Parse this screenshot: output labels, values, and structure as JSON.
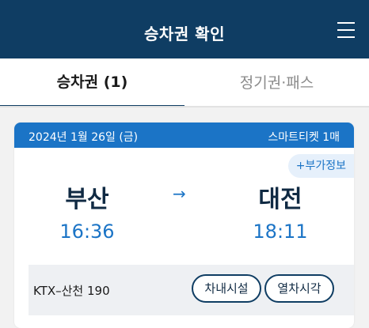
{
  "header": {
    "title": "승차권 확인",
    "menu_icon": "hamburger-menu-icon"
  },
  "tabs": [
    {
      "label": "승차권 (1)",
      "active": true
    },
    {
      "label": "정기권·패스",
      "active": false
    }
  ],
  "ticket": {
    "date": "2024년 1월 26일 (금)",
    "ticket_type": "스마트티켓 1매",
    "extra_info": "+부가정보",
    "departure": {
      "station": "부산",
      "time": "16:36"
    },
    "arrival": {
      "station": "대전",
      "time": "18:11"
    },
    "arrow": "→",
    "train": "KTX–산천 190",
    "buttons": {
      "facilities": "차내시설",
      "timetable": "열차시각"
    }
  }
}
